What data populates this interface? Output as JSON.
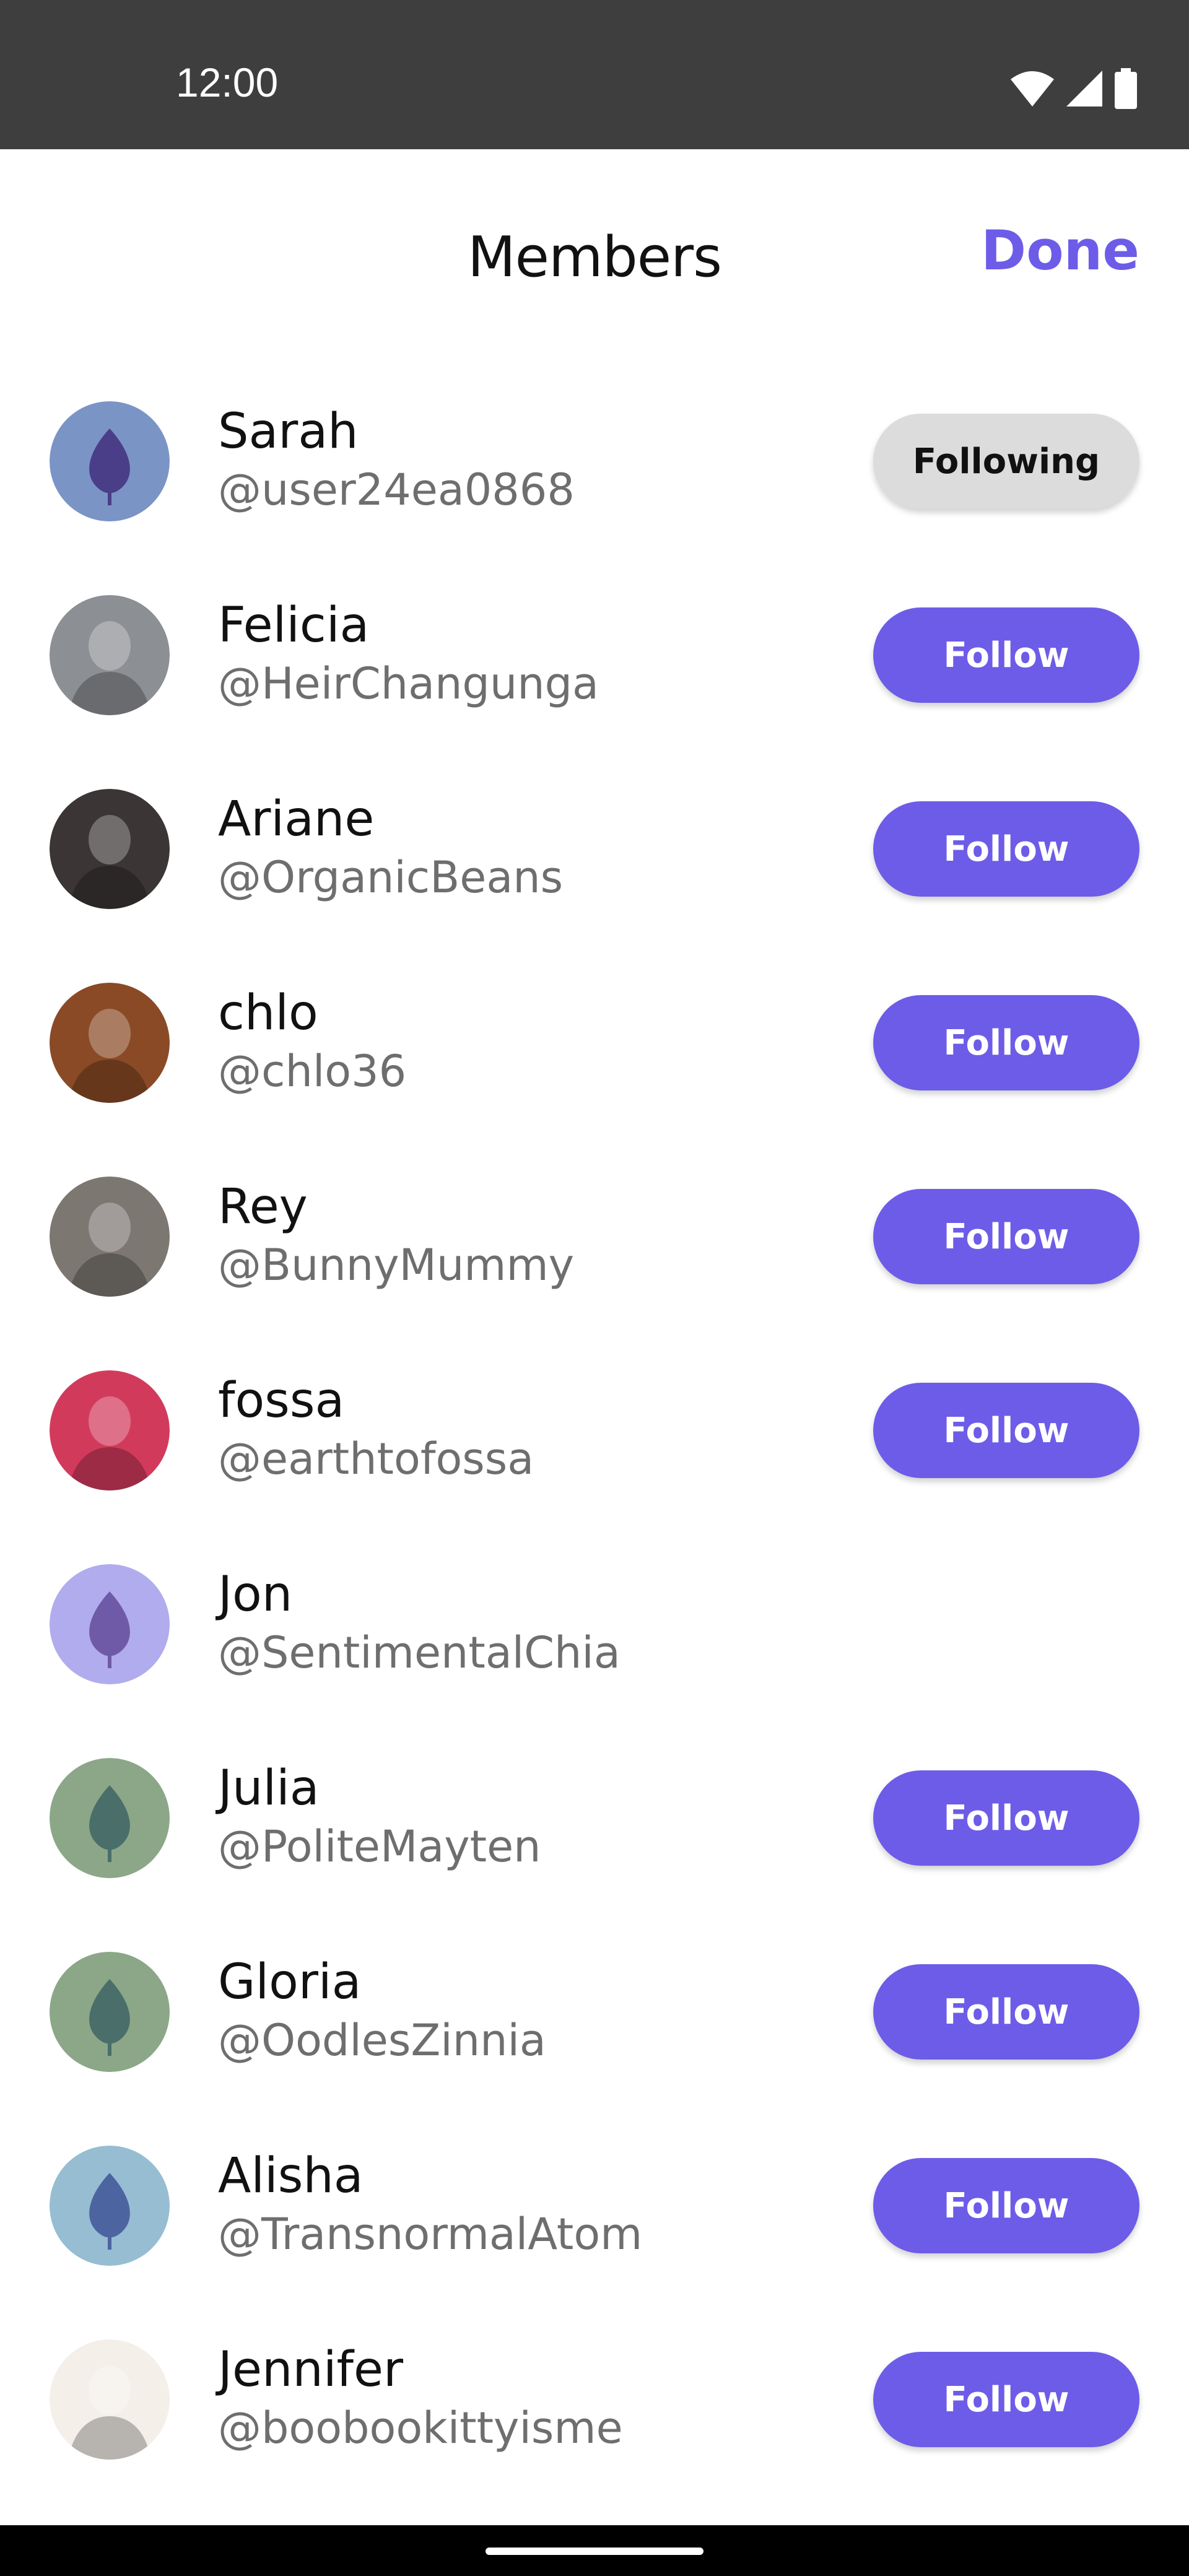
{
  "status_bar": {
    "time": "12:00",
    "icons": [
      "wifi-icon",
      "signal-icon",
      "battery-icon"
    ]
  },
  "header": {
    "title": "Members",
    "done_label": "Done"
  },
  "colors": {
    "accent": "#6d5ce8",
    "following_bg": "#dcdcdc",
    "status_bar_bg": "#3e3e3e"
  },
  "members": [
    {
      "name": "Sarah",
      "handle": "@user24ea0868",
      "button": "Following",
      "avatar": "leaf-icon",
      "avatar_bg": "#7b94c6",
      "leaf_color": "#4a3e88"
    },
    {
      "name": "Felicia",
      "handle": "@HeirChangunga",
      "button": "Follow",
      "avatar": "photo",
      "avatar_bg": "#8c8f93"
    },
    {
      "name": "Ariane",
      "handle": "@OrganicBeans",
      "button": "Follow",
      "avatar": "photo",
      "avatar_bg": "#3b3535"
    },
    {
      "name": "chlo",
      "handle": "@chlo36",
      "button": "Follow",
      "avatar": "photo",
      "avatar_bg": "#8a4a26"
    },
    {
      "name": "Rey",
      "handle": "@BunnyMummy",
      "button": "Follow",
      "avatar": "photo",
      "avatar_bg": "#7d7772"
    },
    {
      "name": "fossa",
      "handle": "@earthtofossa",
      "button": "Follow",
      "avatar": "photo",
      "avatar_bg": "#d23a5c"
    },
    {
      "name": "Jon",
      "handle": "@SentimentalChia",
      "button": "",
      "avatar": "leaf-icon",
      "avatar_bg": "#b1aced",
      "leaf_color": "#6f5aa8"
    },
    {
      "name": "Julia",
      "handle": "@PoliteMayten",
      "button": "Follow",
      "avatar": "leaf-icon",
      "avatar_bg": "#8ba788",
      "leaf_color": "#4a6e6a"
    },
    {
      "name": "Gloria",
      "handle": "@OodlesZinnia",
      "button": "Follow",
      "avatar": "leaf-icon",
      "avatar_bg": "#8ba788",
      "leaf_color": "#4a6e6a"
    },
    {
      "name": "Alisha",
      "handle": "@TransnormalAtom",
      "button": "Follow",
      "avatar": "leaf-icon",
      "avatar_bg": "#96bdd2",
      "leaf_color": "#4c64a0"
    },
    {
      "name": "Jennifer",
      "handle": "@boobookittyisme",
      "button": "Follow",
      "avatar": "photo",
      "avatar_bg": "#f4efe9"
    }
  ]
}
